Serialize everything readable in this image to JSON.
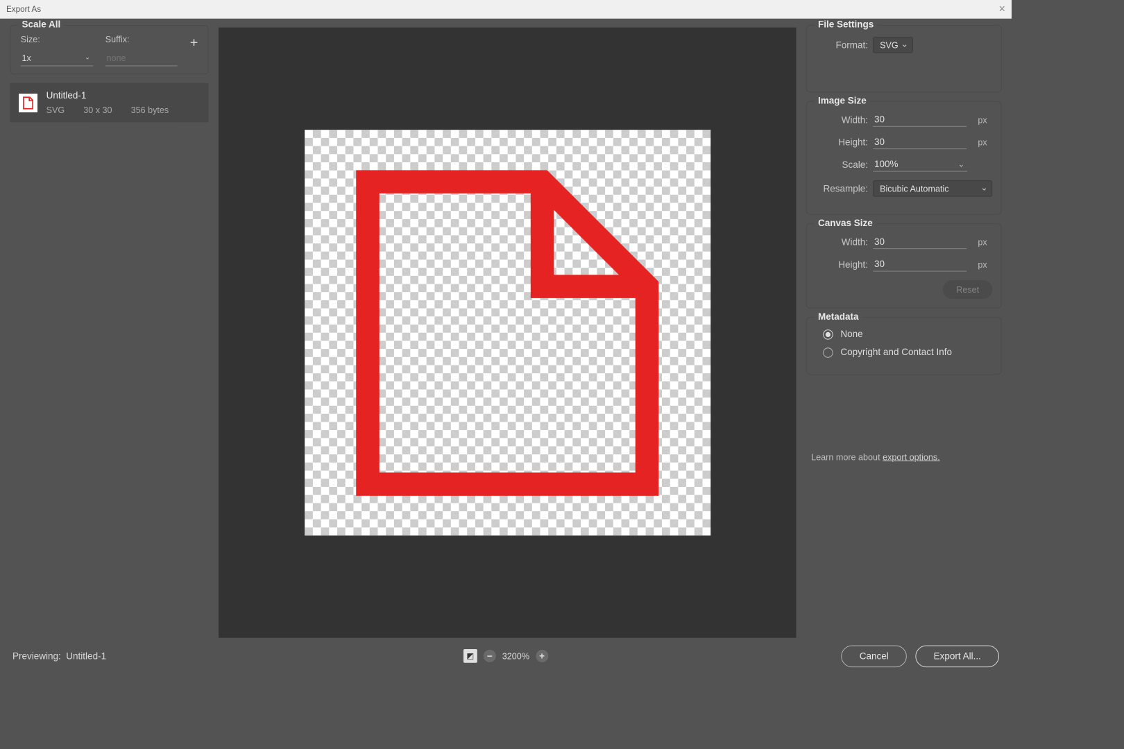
{
  "window": {
    "title": "Export As"
  },
  "scaleAll": {
    "title": "Scale All",
    "sizeLabel": "Size:",
    "suffixLabel": "Suffix:",
    "sizeValue": "1x",
    "suffixPlaceholder": "none"
  },
  "asset": {
    "name": "Untitled-1",
    "format": "SVG",
    "dimensions": "30 x 30",
    "filesize": "356 bytes"
  },
  "fileSettings": {
    "title": "File Settings",
    "formatLabel": "Format:",
    "formatValue": "SVG"
  },
  "imageSize": {
    "title": "Image Size",
    "widthLabel": "Width:",
    "widthValue": "30",
    "heightLabel": "Height:",
    "heightValue": "30",
    "scaleLabel": "Scale:",
    "scaleValue": "100%",
    "resampleLabel": "Resample:",
    "resampleValue": "Bicubic Automatic",
    "unit": "px"
  },
  "canvasSize": {
    "title": "Canvas Size",
    "widthLabel": "Width:",
    "widthValue": "30",
    "heightLabel": "Height:",
    "heightValue": "30",
    "resetLabel": "Reset",
    "unit": "px"
  },
  "metadata": {
    "title": "Metadata",
    "none": "None",
    "copyright": "Copyright and Contact Info"
  },
  "help": {
    "prefix": "Learn more about ",
    "link": "export options."
  },
  "footer": {
    "previewingLabel": "Previewing:",
    "previewingName": "Untitled-1",
    "zoom": "3200%",
    "cancel": "Cancel",
    "export": "Export All..."
  }
}
